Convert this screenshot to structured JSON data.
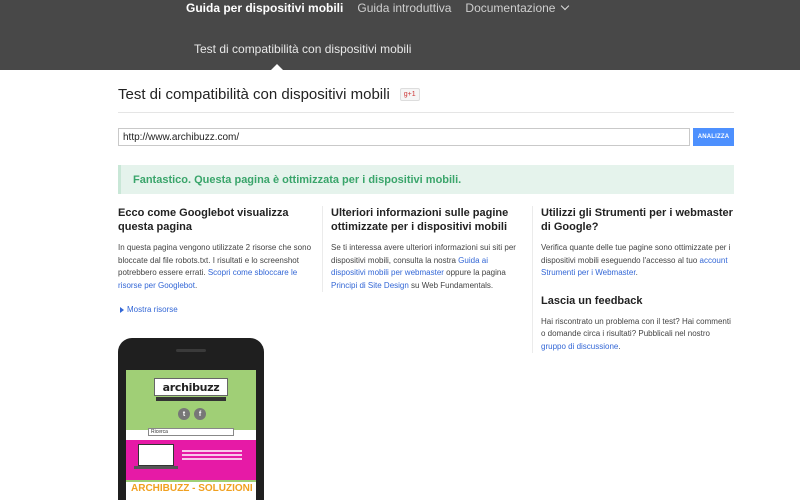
{
  "header": {
    "nav": [
      {
        "label": "Guida per dispositivi mobili",
        "active": true
      },
      {
        "label": "Guida introduttiva",
        "active": false
      },
      {
        "label": "Documentazione",
        "active": false,
        "dropdown": true
      }
    ],
    "subnav_label": "Test di compatibilità con dispositivi mobili"
  },
  "page": {
    "title": "Test di compatibilità con dispositivi mobili",
    "gplus": "g+1"
  },
  "form": {
    "url_value": "http://www.archibuzz.com/",
    "analyze_label": "ANALIZZA"
  },
  "result": {
    "message": "Fantastico. Questa pagina è ottimizzata per i dispositivi mobili."
  },
  "col1": {
    "heading": "Ecco come Googlebot visualizza questa pagina",
    "text": "In questa pagina vengono utilizzate 2 risorse che sono bloccate dal file robots.txt. I risultati e lo screenshot potrebbero essere errati. ",
    "link": "Scopri come sbloccare le risorse per Googlebot",
    "text_end": ".",
    "show_resources": "Mostra risorse"
  },
  "col2": {
    "heading": "Ulteriori informazioni sulle pagine ottimizzate per i dispositivi mobili",
    "text1": "Se ti interessa avere ulteriori informazioni sui siti per dispositivi mobili, consulta la nostra ",
    "link1": "Guida ai dispositivi mobili per webmaster",
    "text2": " oppure la pagina ",
    "link2": "Principi di Site Design",
    "text3": " su Web Fundamentals."
  },
  "col3": {
    "heading": "Utilizzi gli Strumenti per i webmaster di Google?",
    "text1": "Verifica quante delle tue pagine sono ottimizzate per i dispositivi mobili eseguendo l'accesso al tuo ",
    "link1": "account Strumenti per i Webmaster",
    "text1_end": ".",
    "feedback_heading": "Lascia un feedback",
    "text2": "Hai riscontrato un problema con il test? Hai commenti o domande circa i risultati? Pubblicali nel nostro ",
    "link2": "gruppo di discussione",
    "text2_end": "."
  },
  "phone_preview": {
    "logo": "archibuzz",
    "search_placeholder": "Ricerca",
    "banner_title": "ARCHIBUZZ - SOLUZIONI"
  }
}
